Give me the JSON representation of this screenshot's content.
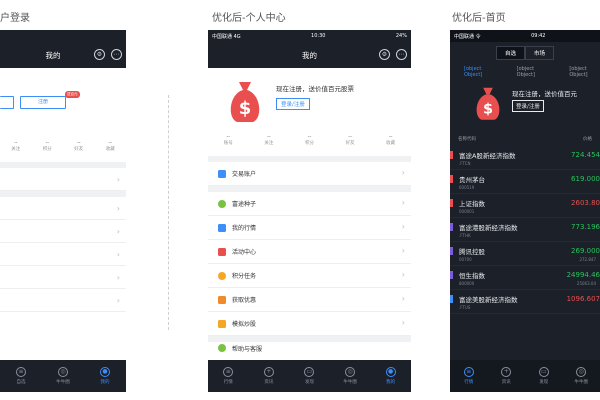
{
  "captions": {
    "left": "户登录",
    "middle": "优化后-个人中心",
    "right": "优化后-首页"
  },
  "phone1": {
    "nav_title": "我的",
    "register_label": "",
    "login_label": "注册",
    "badge": "送百元",
    "stats": [
      {
        "value": "--",
        "label": "关注"
      },
      {
        "value": "--",
        "label": "积分"
      },
      {
        "value": "--",
        "label": "好友"
      },
      {
        "value": "--",
        "label": "收藏"
      }
    ],
    "tabs": [
      {
        "label": "自选"
      },
      {
        "label": "牛牛圈"
      },
      {
        "label": "我的"
      }
    ]
  },
  "phone2": {
    "status_left": "中国联通 4G",
    "status_time": "10:30",
    "status_right": "24%",
    "nav_title": "我的",
    "banner_text": "现在注册，送价值百元股票",
    "banner_button": "登录/注册",
    "stats": [
      {
        "value": "--",
        "label": "账号"
      },
      {
        "value": "--",
        "label": "关注"
      },
      {
        "value": "--",
        "label": "积分"
      },
      {
        "value": "--",
        "label": "好友"
      },
      {
        "value": "--",
        "label": "收藏"
      }
    ],
    "account_item": "交易账户",
    "menu": [
      {
        "label": "富途种子",
        "color": "#7ac142"
      },
      {
        "label": "我的行情",
        "color": "#3e8ef7"
      },
      {
        "label": "活动中心",
        "color": "#e94f4f"
      },
      {
        "label": "积分任务",
        "color": "#f5a623"
      },
      {
        "label": "获取优惠",
        "color": "#f08a2c"
      },
      {
        "label": "模拟炒股",
        "color": "#f5a623"
      }
    ],
    "partial_item": "帮助与客服",
    "tabs": [
      {
        "label": "行情"
      },
      {
        "label": "资讯"
      },
      {
        "label": "发现"
      },
      {
        "label": "牛牛圈"
      },
      {
        "label": "我的"
      }
    ]
  },
  "phone3": {
    "status_left": "中国联通 令",
    "status_time": "09:42",
    "status_right": "",
    "segments": [
      "自选",
      "市场"
    ],
    "tabs": [
      {
        "label": "行情"
      },
      {
        "label": "资讯"
      },
      {
        "label": "发现"
      },
      {
        "label": "牛牛圈"
      }
    ],
    "banner_text": "现在注册，送价值百元",
    "banner_button": "登录/注册",
    "col_name": "名称代码",
    "col_price": "价格",
    "rows": [
      {
        "name": "富途A股新经济指数",
        "code": ".FTCN",
        "price": "724.454",
        "color": "#27c45a",
        "mark": "#e94f4f"
      },
      {
        "name": "贵州茅台",
        "code": "600519",
        "price": "619.000",
        "color": "#27c45a",
        "mark": "#e94f4f"
      },
      {
        "name": "上证指数",
        "code": "000001",
        "price": "2603.80",
        "color": "#e94f4f",
        "mark": "#e94f4f"
      },
      {
        "name": "富途港股新经济指数",
        "code": ".FTHK",
        "price": "773.196",
        "color": "#27c45a",
        "mark": "#7b5cd6"
      },
      {
        "name": "腾讯控股",
        "code": "00700",
        "price": "269.000",
        "sub": "272.847",
        "color": "#27c45a",
        "mark": "#7b5cd6"
      },
      {
        "name": "恒生指数",
        "code": "800000",
        "price": "24994.46",
        "sub": "25063.04",
        "color": "#27c45a",
        "mark": "#7b5cd6"
      },
      {
        "name": "富途美股新经济指数",
        "code": ".FTUS",
        "price": "1096.607",
        "color": "#e94f4f",
        "mark": "#3e8ef7"
      }
    ]
  }
}
